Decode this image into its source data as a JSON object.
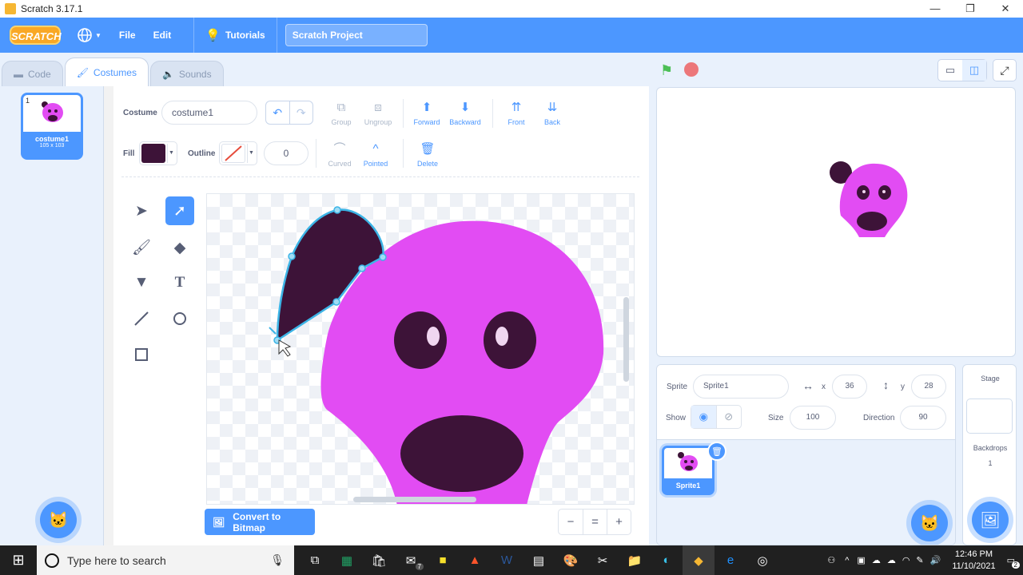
{
  "window": {
    "title": "Scratch 3.17.1",
    "minimize": "—",
    "restore": "❐",
    "close": "✕"
  },
  "menubar": {
    "logo": "SCRATCH",
    "file": "File",
    "edit": "Edit",
    "tutorials": "Tutorials",
    "project_title": "Scratch Project"
  },
  "tabs": {
    "code": "Code",
    "costumes": "Costumes",
    "sounds": "Sounds"
  },
  "costume_list": {
    "items": [
      {
        "number": "1",
        "name": "costume1",
        "size": "105 x 103"
      }
    ]
  },
  "editor": {
    "costume_label": "Costume",
    "costume_name": "costume1",
    "fill_label": "Fill",
    "outline_label": "Outline",
    "outline_width": "0",
    "fill_color": "#3d1338",
    "buttons": {
      "group": "Group",
      "ungroup": "Ungroup",
      "forward": "Forward",
      "backward": "Backward",
      "front": "Front",
      "back": "Back",
      "curved": "Curved",
      "pointed": "Pointed",
      "delete": "Delete"
    },
    "convert_label": "Convert to Bitmap",
    "zoom_out": "−",
    "zoom_reset": "=",
    "zoom_in": "+"
  },
  "sprite_info": {
    "sprite_label": "Sprite",
    "sprite_name": "Sprite1",
    "x_label": "x",
    "x_value": "36",
    "y_label": "y",
    "y_value": "28",
    "show_label": "Show",
    "size_label": "Size",
    "size_value": "100",
    "direction_label": "Direction",
    "direction_value": "90"
  },
  "sprites": [
    {
      "name": "Sprite1"
    }
  ],
  "stage_pane": {
    "title": "Stage",
    "backdrops_label": "Backdrops",
    "backdrops_count": "1"
  },
  "taskbar": {
    "search_placeholder": "Type here to search",
    "time": "12:46 PM",
    "date": "11/10/2021",
    "notifications": "2",
    "mail_badge": "7"
  },
  "colors": {
    "accent": "#4c97ff",
    "body_pink": "#e24cf3",
    "dark_purple": "#3d1338"
  }
}
